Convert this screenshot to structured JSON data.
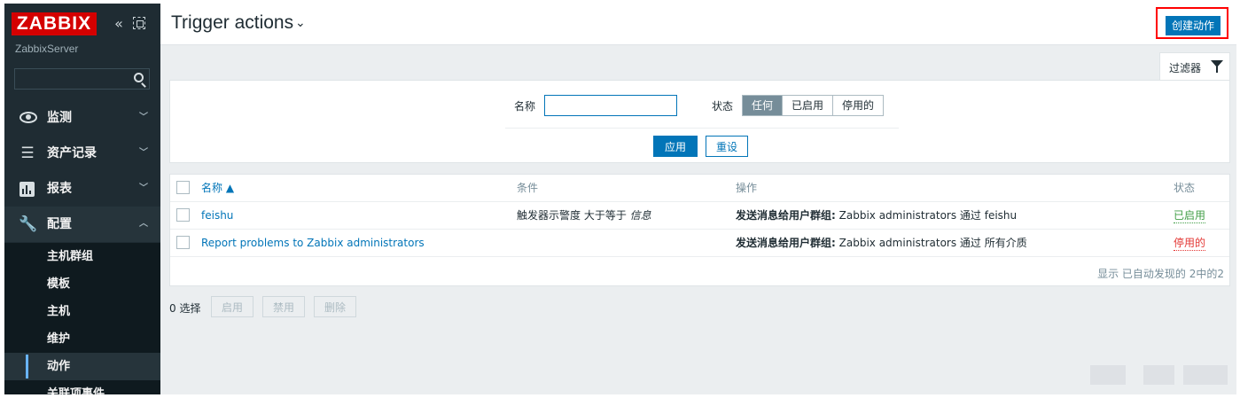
{
  "sidebar": {
    "logo": "ZABBIX",
    "server_name": "ZabbixServer",
    "search_placeholder": "",
    "menu": [
      {
        "label": "监测",
        "icon": "eye-icon"
      },
      {
        "label": "资产记录",
        "icon": "list-icon"
      },
      {
        "label": "报表",
        "icon": "bar-chart-icon"
      },
      {
        "label": "配置",
        "icon": "wrench-icon"
      }
    ],
    "submenu": [
      {
        "label": "主机群组"
      },
      {
        "label": "模板"
      },
      {
        "label": "主机"
      },
      {
        "label": "维护"
      },
      {
        "label": "动作"
      },
      {
        "label": "关联项事件"
      }
    ]
  },
  "header": {
    "title": "Trigger actions",
    "create_button": "创建动作"
  },
  "filter": {
    "tab_label": "过滤器",
    "name_label": "名称",
    "name_value": "",
    "status_label": "状态",
    "status_options": [
      "任何",
      "已启用",
      "停用的"
    ],
    "status_selected": "任何",
    "apply_button": "应用",
    "reset_button": "重设"
  },
  "table": {
    "headers": {
      "name": "名称 ▲",
      "conditions": "条件",
      "operations": "操作",
      "status": "状态"
    },
    "rows": [
      {
        "name": "feishu",
        "condition_prefix": "触发器示警度 大于等于",
        "condition_value": "信息",
        "operation_label": "发送消息给用户群组:",
        "operation_text": "Zabbix administrators 通过 feishu",
        "status": "已启用"
      },
      {
        "name": "Report problems to Zabbix administrators",
        "condition_prefix": "",
        "condition_value": "",
        "operation_label": "发送消息给用户群组:",
        "operation_text": "Zabbix administrators 通过 所有介质",
        "status": "停用的"
      }
    ],
    "footer": "显示 已自动发现的 2中的2"
  },
  "mass_actions": {
    "selected": "0 选择",
    "enable": "启用",
    "disable": "禁用",
    "delete": "删除"
  },
  "colors": {
    "sidebar_bg": "#1f2c33",
    "accent_blue": "#0275b8",
    "logo_red": "#d40000",
    "status_enabled": "#429e47",
    "status_disabled": "#e33734",
    "highlight_box": "#ff0000"
  }
}
